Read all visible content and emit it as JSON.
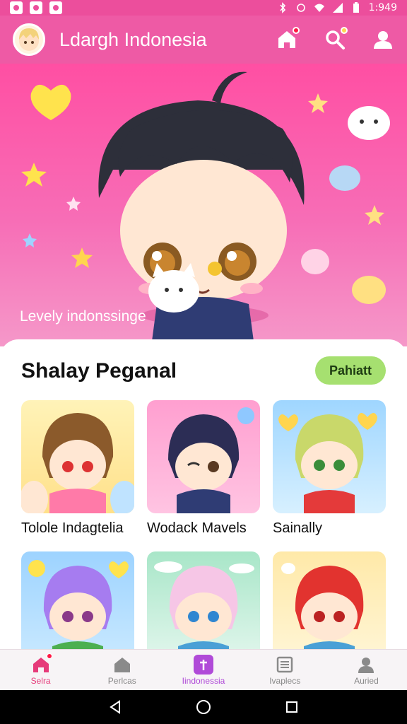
{
  "status_bar": {
    "time": "1:949"
  },
  "app_bar": {
    "title": "Ldargh Indonesia"
  },
  "hero": {
    "caption": "Levely indonssinge"
  },
  "section": {
    "title": "Shalay Peganal",
    "button_label": "Pahiatt"
  },
  "cards": [
    {
      "label": "Tolole Indagtelia"
    },
    {
      "label": "Wodack Mavels"
    },
    {
      "label": "Sainally"
    },
    {
      "label": ""
    },
    {
      "label": ""
    },
    {
      "label": ""
    }
  ],
  "bottom_nav": [
    {
      "label": "Selra"
    },
    {
      "label": "Perlcas"
    },
    {
      "label": "Iindonessia"
    },
    {
      "label": "Ivaplecs"
    },
    {
      "label": "Auried"
    }
  ],
  "colors": {
    "app_bar": "#ee5aa5",
    "accent_button": "#a6e070",
    "active_center": "#b04ad8",
    "active_home": "#e63b7a"
  }
}
